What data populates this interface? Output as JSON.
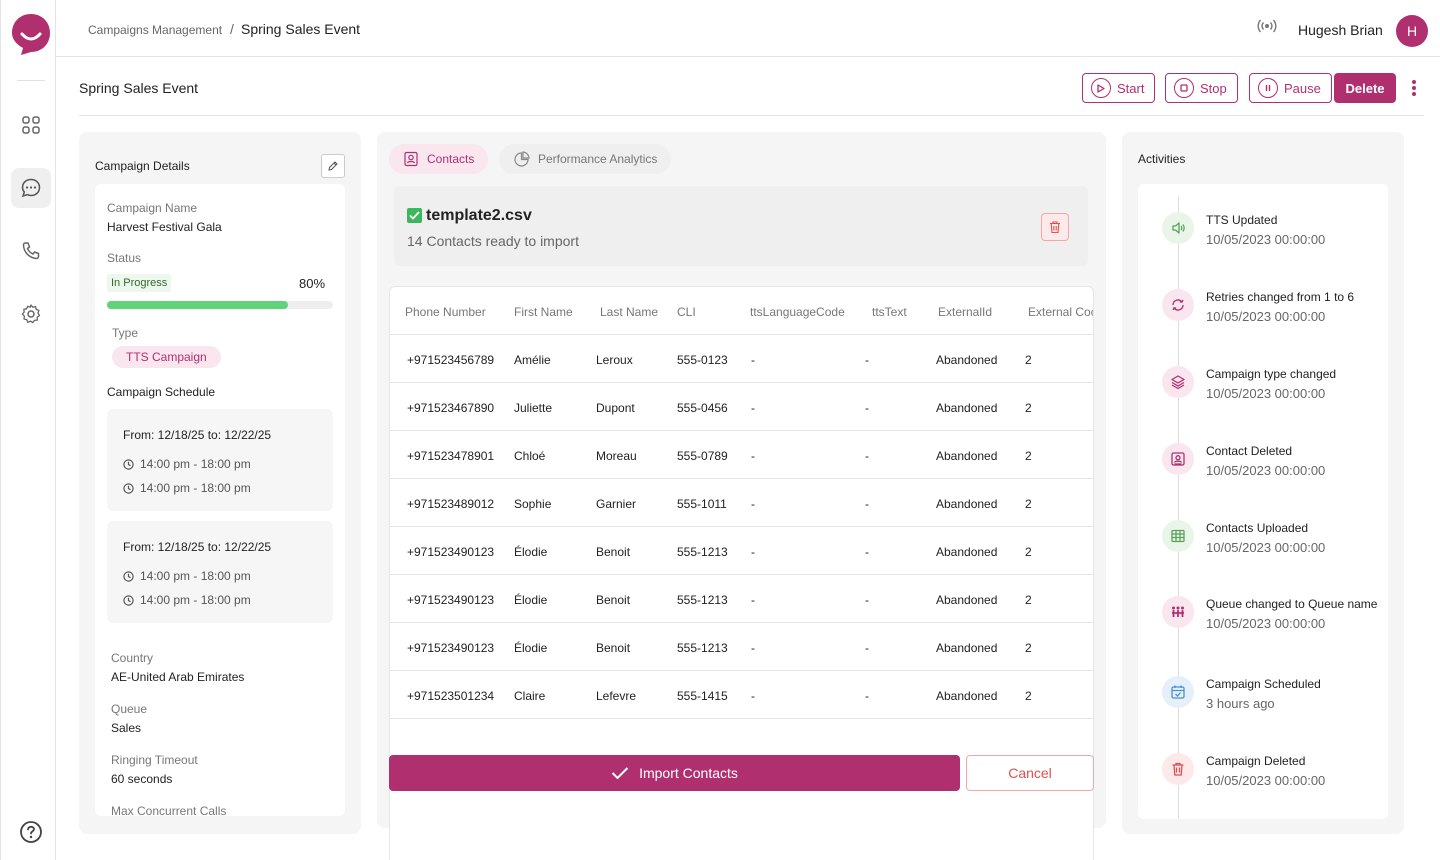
{
  "breadcrumb": {
    "parent": "Campaigns Management",
    "separator": "/",
    "current": "Spring Sales Event"
  },
  "user": {
    "name": "Hugesh Brian",
    "initial": "H"
  },
  "page": {
    "title": "Spring Sales Event"
  },
  "actions": {
    "start": "Start",
    "stop": "Stop",
    "pause": "Pause",
    "delete": "Delete"
  },
  "details": {
    "title": "Campaign Details",
    "campaign_name_label": "Campaign Name",
    "campaign_name": "Harvest Festival Gala",
    "status_label": "Status",
    "status": "In Progress",
    "progress_text": "80%",
    "progress_fraction": 0.8,
    "type_label": "Type",
    "type": "TTS Campaign",
    "schedule_title": "Campaign Schedule",
    "schedules": [
      {
        "range": "From:  12/18/25  to: 12/22/25",
        "slot1": "14:00 pm - 18:00 pm",
        "slot2": "14:00 pm - 18:00 pm"
      },
      {
        "range": "From:  12/18/25  to: 12/22/25",
        "slot1": "14:00 pm - 18:00 pm",
        "slot2": "14:00 pm - 18:00 pm"
      }
    ],
    "country_label": "Country",
    "country": "AE-United Arab Emirates",
    "queue_label": "Queue",
    "queue": "Sales",
    "ringing_label": "Ringing Timeout",
    "ringing": "60 seconds",
    "max_calls_label": "Max Concurrent Calls"
  },
  "tabs": {
    "contacts": "Contacts",
    "analytics": "Performance Analytics"
  },
  "file": {
    "name": "template2.csv",
    "subtitle": "14 Contacts ready to import"
  },
  "table": {
    "headers": [
      "Phone Number",
      "First Name",
      "Last Name",
      "CLI",
      "ttsLanguageCode",
      "ttsText",
      "ExternalId",
      "External Coc"
    ],
    "rows": [
      [
        "+971523456789",
        "Amélie",
        "Leroux",
        "555-0123",
        "-",
        "-",
        "Abandoned",
        "2"
      ],
      [
        "+971523467890",
        "Juliette",
        "Dupont",
        "555-0456",
        "-",
        "-",
        "Abandoned",
        "2"
      ],
      [
        "+971523478901",
        "Chloé",
        "Moreau",
        "555-0789",
        "-",
        "-",
        "Abandoned",
        "2"
      ],
      [
        "+971523489012",
        "Sophie",
        "Garnier",
        "555-1011",
        "-",
        "-",
        "Abandoned",
        "2"
      ],
      [
        "+971523490123",
        "Élodie",
        "Benoit",
        "555-1213",
        "-",
        "-",
        "Abandoned",
        "2"
      ],
      [
        "+971523490123",
        "Élodie",
        "Benoit",
        "555-1213",
        "-",
        "-",
        "Abandoned",
        "2"
      ],
      [
        "+971523490123",
        "Élodie",
        "Benoit",
        "555-1213",
        "-",
        "-",
        "Abandoned",
        "2"
      ],
      [
        "+971523501234",
        "Claire",
        "Lefevre",
        "555-1415",
        "-",
        "-",
        "Abandoned",
        "2"
      ]
    ]
  },
  "buttons": {
    "import": "Import Contacts",
    "cancel": "Cancel"
  },
  "activities": {
    "title": "Activities",
    "items": [
      {
        "title": "TTS Updated",
        "time": "10/05/2023  00:00:00",
        "icon": "speaker-icon",
        "color": "#5aa05a",
        "bg": "#eaf5ea"
      },
      {
        "title": "Retries changed from 1 to 6",
        "time": "10/05/2023  00:00:00",
        "icon": "refresh-icon",
        "color": "#b0306f",
        "bg": "#f9e6ef"
      },
      {
        "title": "Campaign type changed",
        "time": "10/05/2023  00:00:00",
        "icon": "layers-icon",
        "color": "#b0306f",
        "bg": "#f9e6ef"
      },
      {
        "title": "Contact Deleted",
        "time": "10/05/2023  00:00:00",
        "icon": "contact-card-icon",
        "color": "#b0306f",
        "bg": "#f9e6ef"
      },
      {
        "title": "Contacts Uploaded",
        "time": "10/05/2023  00:00:00",
        "icon": "table-icon",
        "color": "#5aa05a",
        "bg": "#eaf5ea"
      },
      {
        "title": "Queue changed to Queue name",
        "time": "10/05/2023  00:00:00",
        "icon": "queue-icon",
        "color": "#b0306f",
        "bg": "#f9e6ef"
      },
      {
        "title": "Campaign Scheduled",
        "time": "3 hours ago",
        "icon": "calendar-icon",
        "color": "#4a8fd6",
        "bg": "#e6f0fb"
      },
      {
        "title": "Campaign Deleted",
        "time": "10/05/2023  00:00:00",
        "icon": "trash-icon",
        "color": "#e05050",
        "bg": "#fde9e9"
      }
    ]
  },
  "colors": {
    "brand": "#b0306f",
    "progress": "#5fd37a"
  }
}
